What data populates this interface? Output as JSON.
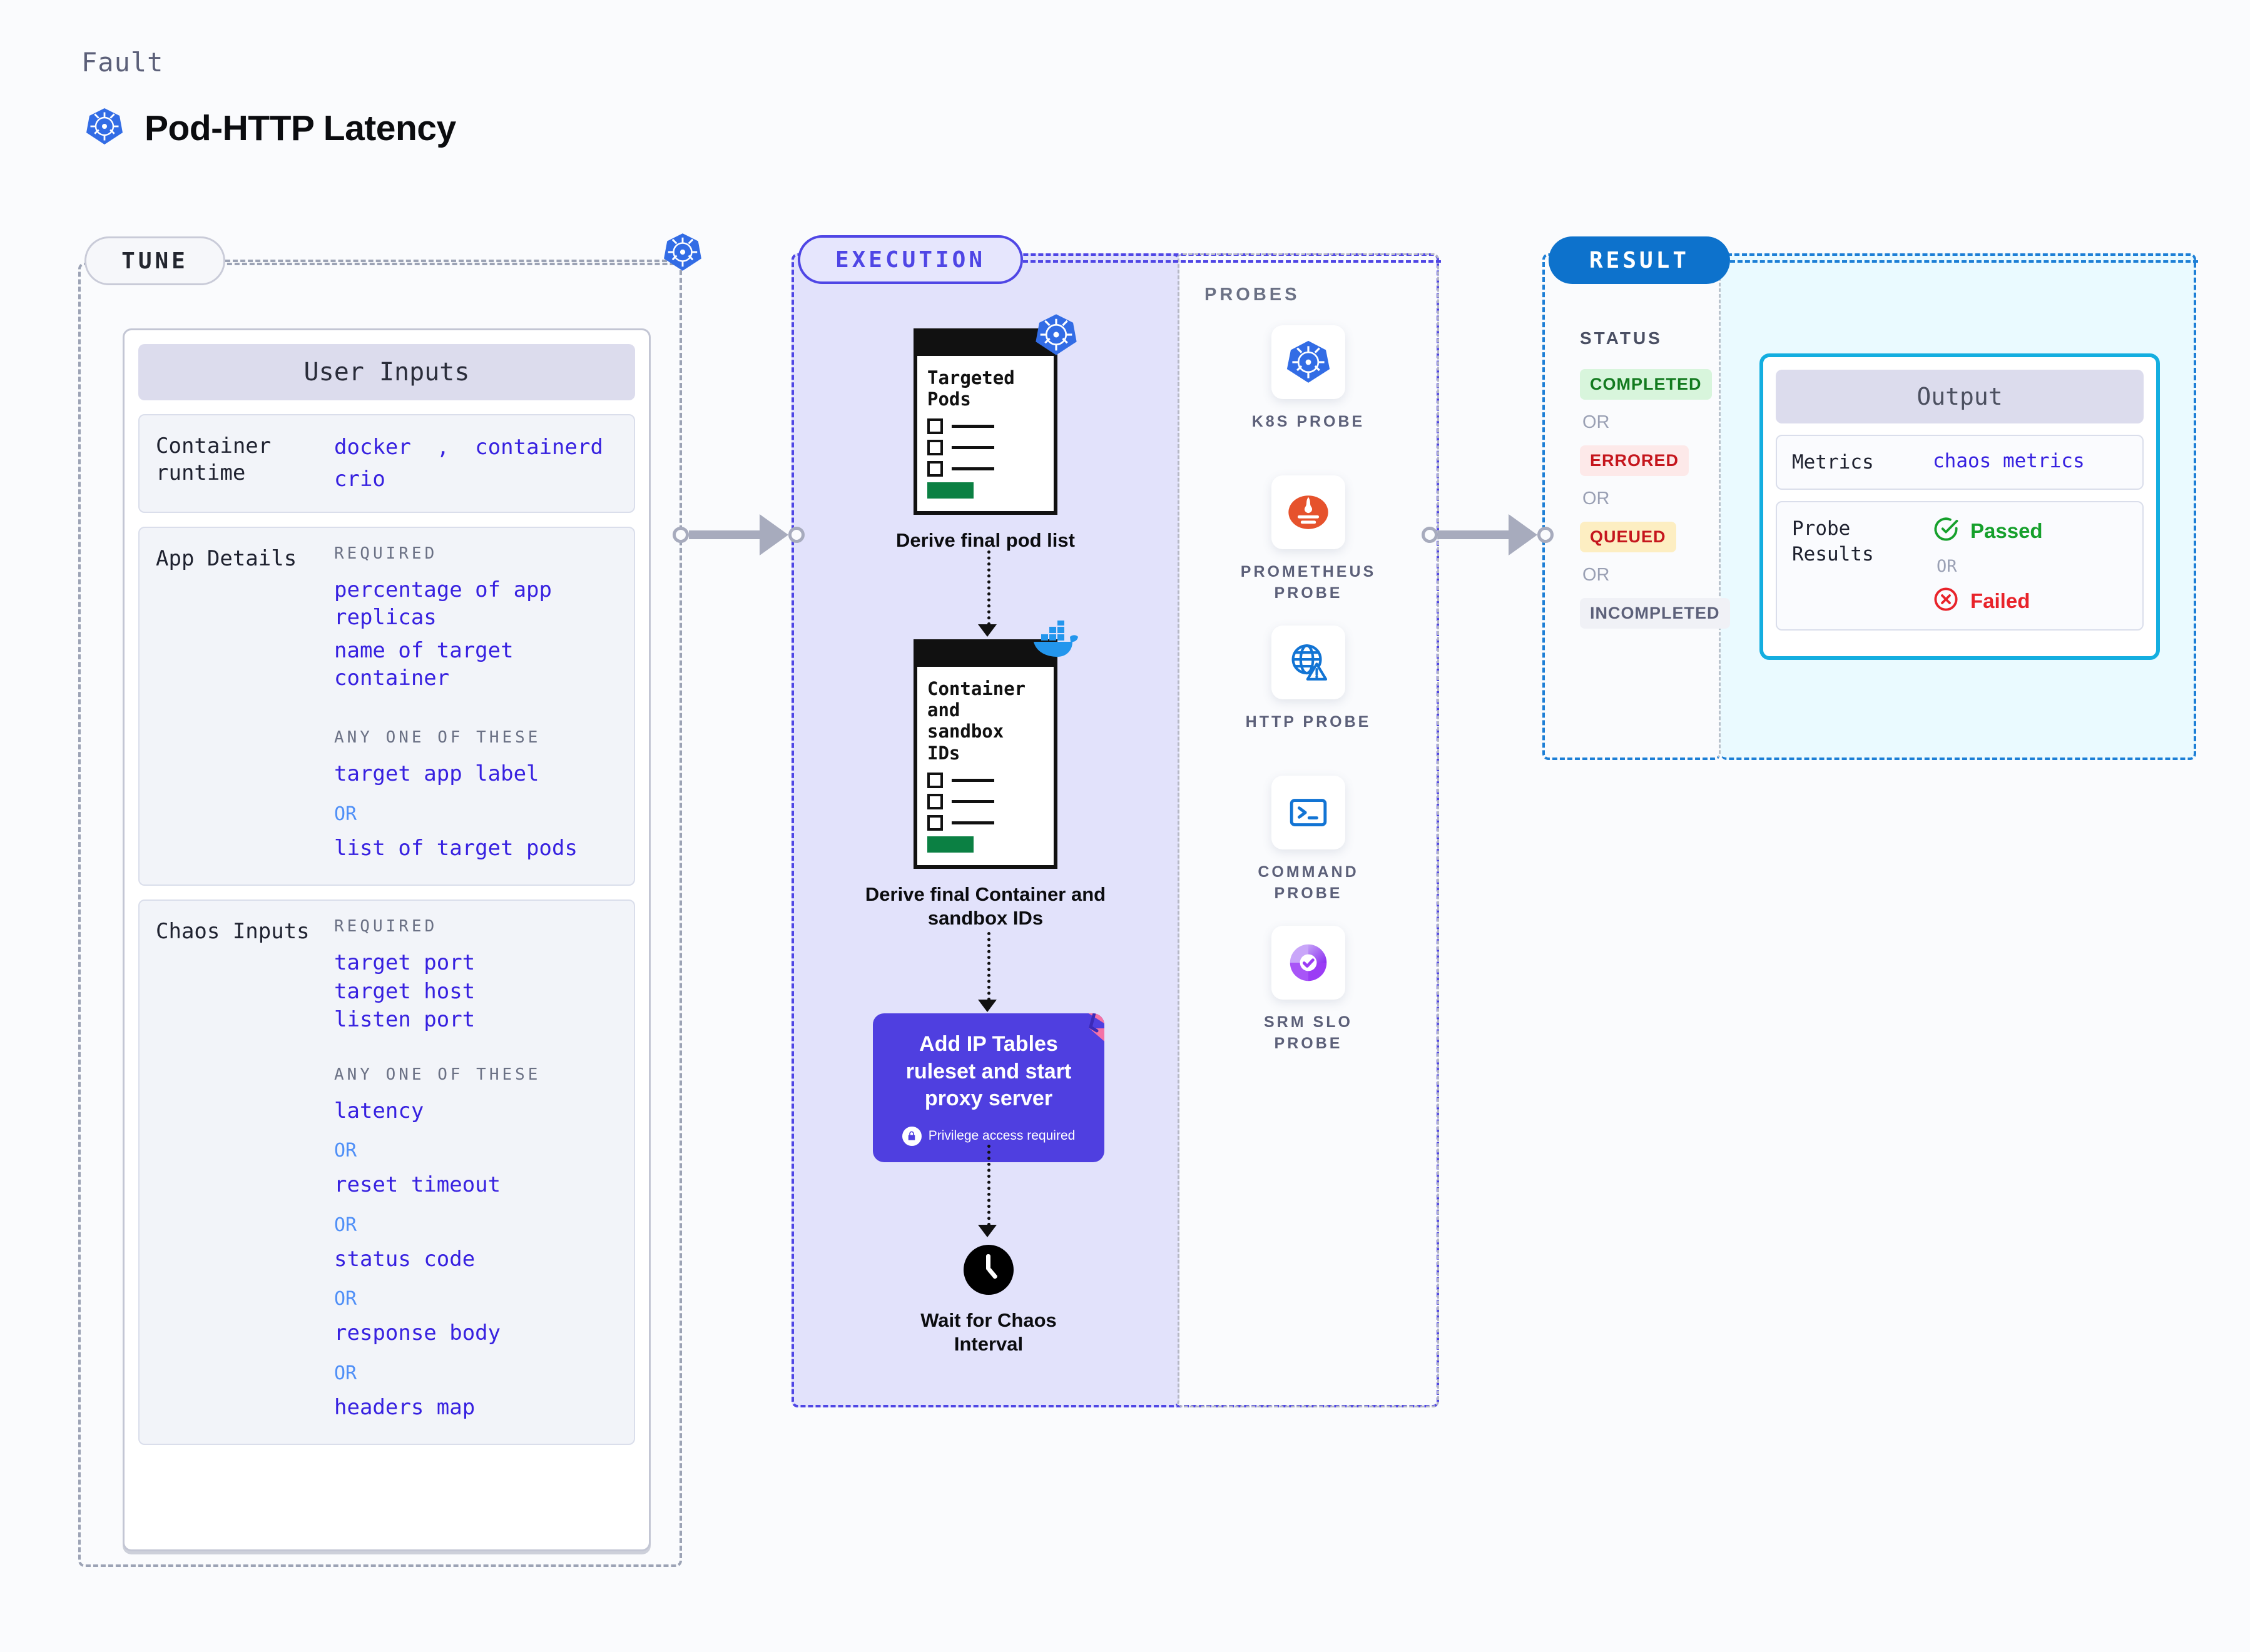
{
  "header": {
    "eyebrow": "Fault",
    "title": "Pod-HTTP Latency",
    "icon": "kubernetes-icon"
  },
  "stages": {
    "tune": "TUNE",
    "execution": "EXECUTION",
    "result": "RESULT"
  },
  "tune": {
    "card_title": "User Inputs",
    "blocks": [
      {
        "label": "Container\nruntime",
        "inline_values": [
          "docker",
          "containerd",
          "crio"
        ]
      },
      {
        "label": "App Details",
        "required_heading": "REQUIRED",
        "required_values": [
          "percentage of app replicas",
          "name of target container"
        ],
        "anyone_heading": "ANY ONE OF THESE",
        "anyone_values": [
          "target app label",
          "list of target pods"
        ],
        "or_label": "OR"
      },
      {
        "label": "Chaos Inputs",
        "required_heading": "REQUIRED",
        "required_values": [
          "target port",
          "target host",
          "listen port"
        ],
        "anyone_heading": "ANY ONE OF THESE",
        "anyone_values": [
          "latency",
          "reset timeout",
          "status code",
          "response body",
          "headers map"
        ],
        "or_label": "OR"
      }
    ]
  },
  "execution": {
    "nodes": [
      {
        "doc_title": "Targeted\nPods",
        "caption": "Derive final pod list",
        "badge_icon": "kubernetes-icon"
      },
      {
        "doc_title": "Container\nand\nsandbox\nIDs",
        "caption": "Derive final Container and sandbox IDs",
        "badge_icon": "docker-icon"
      },
      {
        "title": "Add IP Tables ruleset and start proxy server",
        "note": "Privilege access required",
        "note_icon": "lock-icon",
        "corner_icon": "litmus-flag-icon",
        "color": "#4f3fe0"
      },
      {
        "caption": "Wait for Chaos Interval",
        "icon": "clock-icon"
      }
    ]
  },
  "probes": {
    "heading": "PROBES",
    "items": [
      {
        "name": "K8S PROBE",
        "icon": "kubernetes-icon"
      },
      {
        "name": "PROMETHEUS PROBE",
        "icon": "prometheus-icon"
      },
      {
        "name": "HTTP PROBE",
        "icon": "globe-warning-icon"
      },
      {
        "name": "COMMAND PROBE",
        "icon": "terminal-icon"
      },
      {
        "name": "SRM SLO PROBE",
        "icon": "srm-slo-icon"
      }
    ]
  },
  "result": {
    "status_heading": "STATUS",
    "or_label": "OR",
    "statuses": [
      {
        "label": "COMPLETED",
        "style": "completed"
      },
      {
        "label": "ERRORED",
        "style": "errored"
      },
      {
        "label": "QUEUED",
        "style": "queued"
      },
      {
        "label": "INCOMPLETED",
        "style": "incomplete"
      }
    ],
    "output": {
      "card_title": "Output",
      "metrics_label": "Metrics",
      "metrics_value": "chaos metrics",
      "probe_results_label": "Probe\nResults",
      "passed_label": "Passed",
      "failed_label": "Failed",
      "or_label": "OR",
      "passed_icon": "check-circle-icon",
      "failed_icon": "x-circle-icon"
    }
  },
  "colors": {
    "accent_purple": "#4f46e5",
    "accent_blue": "#1d7fd6",
    "value_blue": "#3721e0",
    "or_blue": "#4f8ff7",
    "green": "#16a02c",
    "red": "#e8232a",
    "amber": "#fdeec2"
  }
}
